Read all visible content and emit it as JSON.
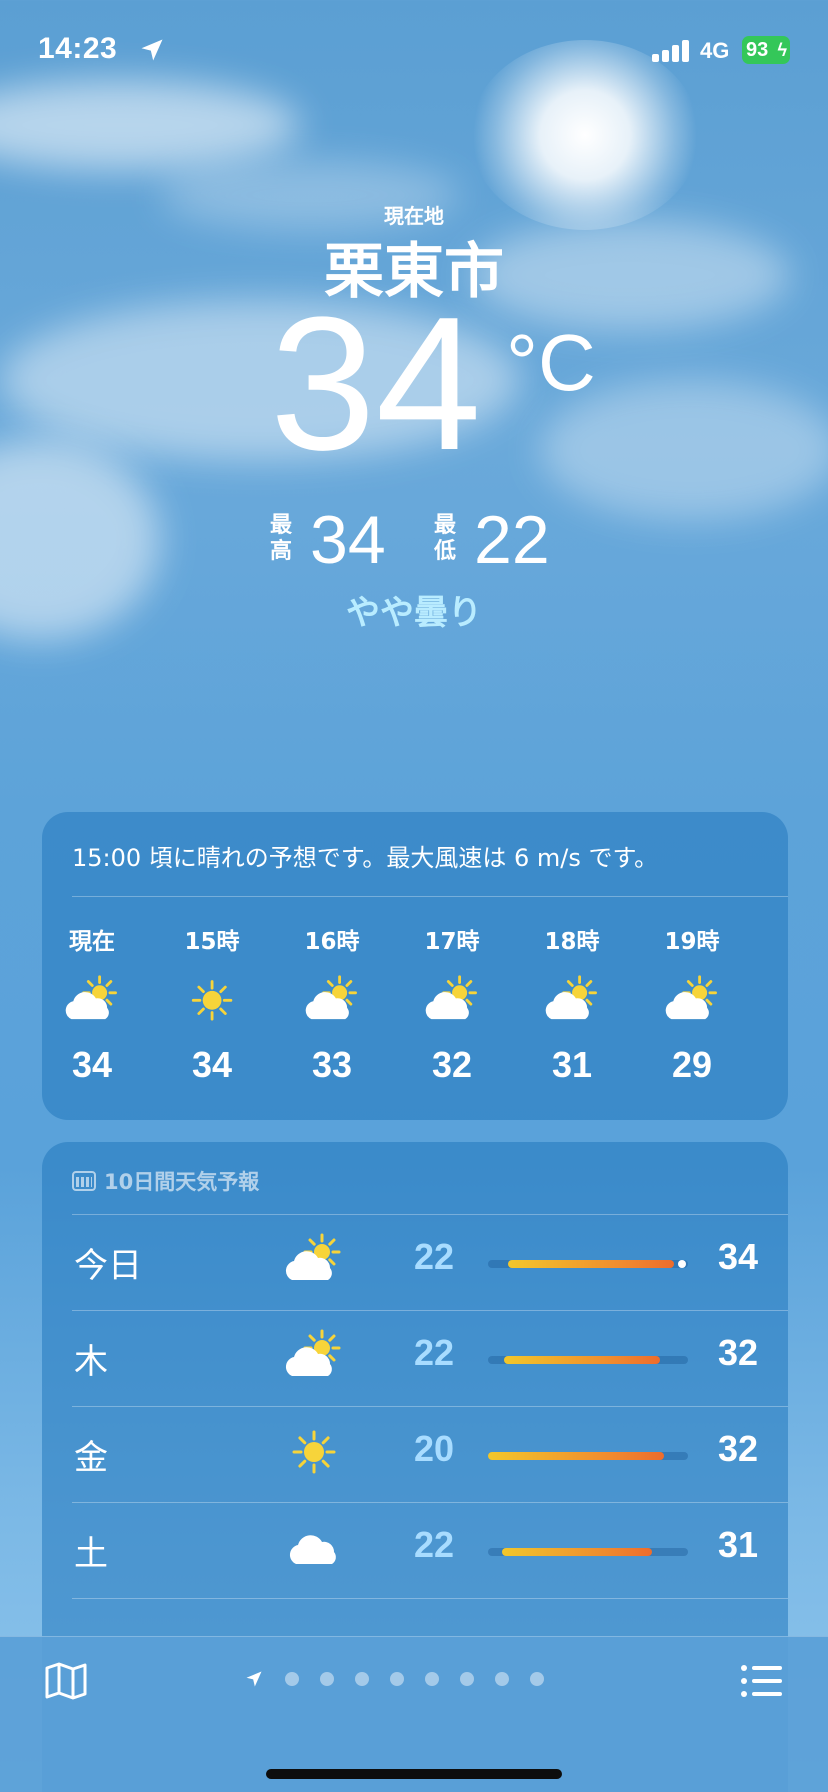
{
  "status_bar": {
    "time": "14:23",
    "network": "4G",
    "battery": "93",
    "battery_color": "#34c759"
  },
  "location": {
    "label": "現在地",
    "city": "栗東市",
    "temperature": "34",
    "unit": "°C",
    "high_label": "最高",
    "high": "34",
    "low_label": "最低",
    "low": "22",
    "condition": "やや曇り"
  },
  "hourly": {
    "summary": "15:00 頃に晴れの予想です。最大風速は 6 m/s です。",
    "items": [
      {
        "label": "現在",
        "icon": "partly-sunny-icon",
        "temp": "34"
      },
      {
        "label": "15時",
        "icon": "sun-icon",
        "temp": "34"
      },
      {
        "label": "16時",
        "icon": "partly-sunny-icon",
        "temp": "33"
      },
      {
        "label": "17時",
        "icon": "partly-sunny-icon",
        "temp": "32"
      },
      {
        "label": "18時",
        "icon": "partly-sunny-icon",
        "temp": "31"
      },
      {
        "label": "19時",
        "icon": "partly-sunny-icon",
        "temp": "29"
      }
    ]
  },
  "daily": {
    "title": "10日間天気予報",
    "items": [
      {
        "day": "今日",
        "icon": "partly-sunny-icon",
        "low": "22",
        "high": "34",
        "range_start": 0.1,
        "range_end": 0.93,
        "current": 0.97
      },
      {
        "day": "木",
        "icon": "partly-sunny-icon",
        "low": "22",
        "high": "32",
        "range_start": 0.08,
        "range_end": 0.86
      },
      {
        "day": "金",
        "icon": "sun-icon",
        "low": "20",
        "high": "32",
        "range_start": 0.0,
        "range_end": 0.88
      },
      {
        "day": "土",
        "icon": "cloud-icon",
        "low": "22",
        "high": "31",
        "range_start": 0.07,
        "range_end": 0.82
      }
    ]
  },
  "bottom_bar": {
    "map_icon": "map-icon",
    "list_icon": "list-icon",
    "page_count": 8
  }
}
